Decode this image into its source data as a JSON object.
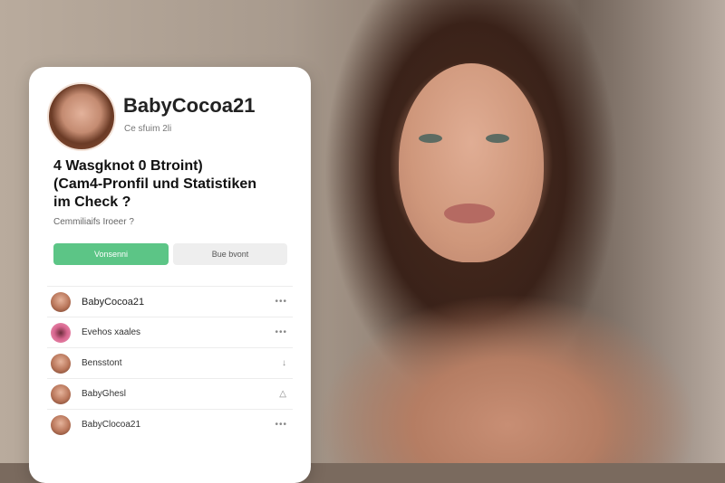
{
  "profile": {
    "username": "BabyCocoa21",
    "subline": "Ce sfuim 2li"
  },
  "headline": {
    "line1": "4 Wasgknot 0 Btroint)",
    "line2": "(Cam4-Pronfil und Statistiken",
    "line3": "im Check ?"
  },
  "question": "Cemmiliaifs Iroeer ?",
  "buttons": {
    "primary": "Vonsenni",
    "secondary": "Bue bvont"
  },
  "list": [
    {
      "label": "BabyCocoa21",
      "trail": "•••",
      "avatar": "avatar"
    },
    {
      "label": "Evehos xaales",
      "trail": "•••",
      "avatar": "pink-avatar"
    },
    {
      "label": "Bensstont",
      "trail": "↓",
      "avatar": "avatar"
    },
    {
      "label": "BabyGhesl",
      "trail": "△",
      "avatar": "avatar"
    },
    {
      "label": "BabyClocoa21",
      "trail": "•••",
      "avatar": "avatar"
    }
  ]
}
